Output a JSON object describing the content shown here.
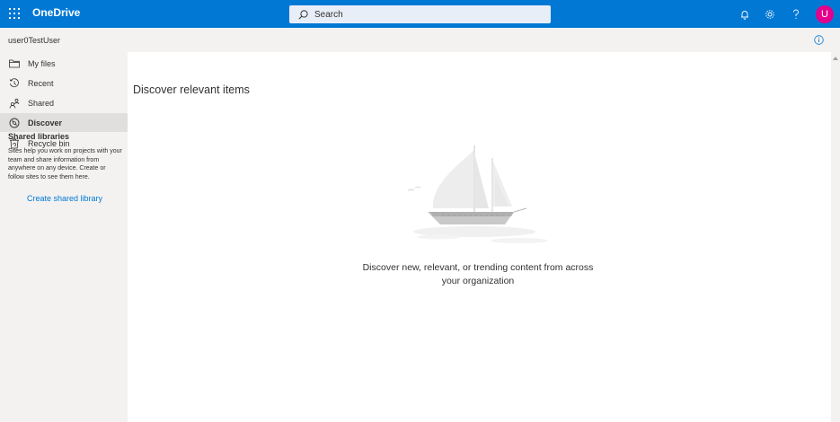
{
  "app": {
    "name": "OneDrive",
    "waffle_icon": "waffle-icon",
    "brand_color": "#0078d4"
  },
  "search": {
    "placeholder": "Search",
    "value": ""
  },
  "header_icons": [
    "bell-icon",
    "gear-icon",
    "help-icon"
  ],
  "user": {
    "avatar_initial": "U",
    "avatar_color": "#e3008c",
    "name": "user0TestUser"
  },
  "sidebar": {
    "items": [
      {
        "label": "My files",
        "icon": "folder-icon",
        "selected": false
      },
      {
        "label": "Recent",
        "icon": "clock-icon",
        "selected": false
      },
      {
        "label": "Shared",
        "icon": "people-icon",
        "selected": false
      },
      {
        "label": "Discover",
        "icon": "compass-icon",
        "selected": true
      },
      {
        "label": "Recycle bin",
        "icon": "recycle-bin-icon",
        "selected": false
      }
    ],
    "libraries": {
      "heading": "Shared libraries",
      "description": "Sites help you work on projects with your team and share information from anywhere on any device. Create or follow sites to see them here.",
      "link": "Create shared library"
    }
  },
  "main": {
    "title": "Discover relevant items",
    "empty_message": "Discover new, relevant, or trending content from across your organization",
    "illustration": "sailboat-illustration"
  }
}
